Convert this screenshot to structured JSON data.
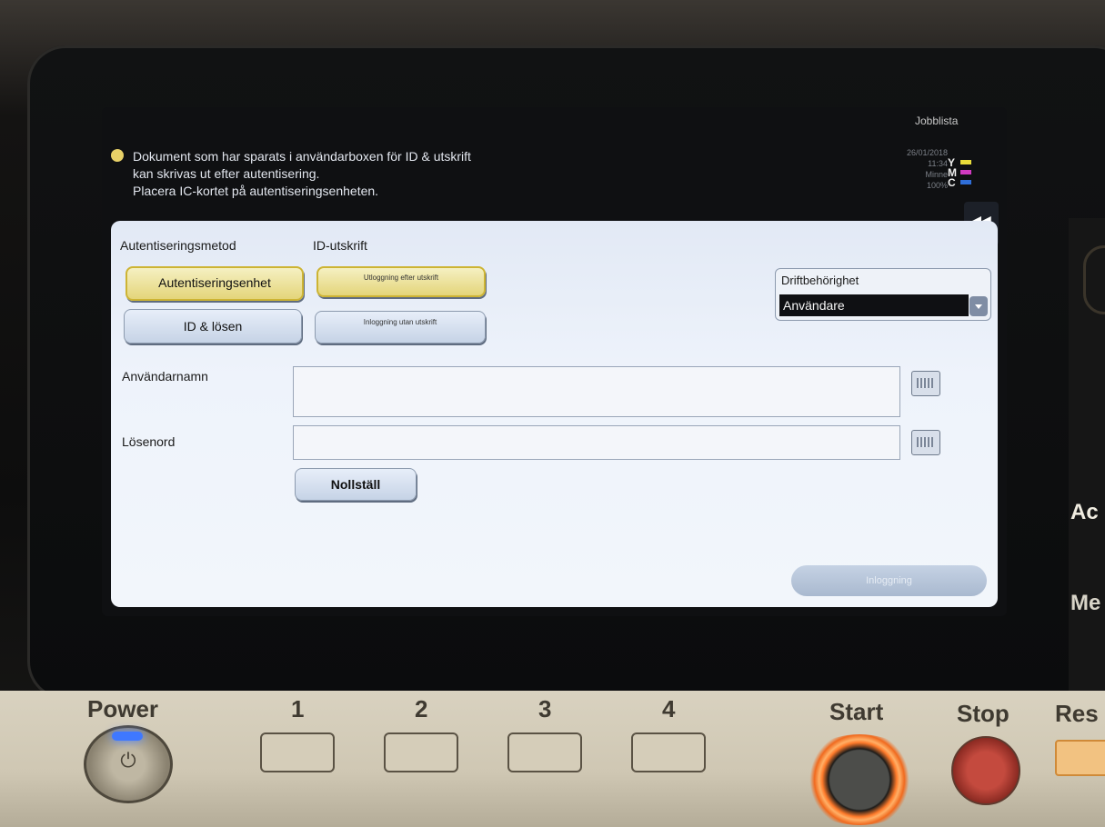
{
  "header": {
    "job_list": "Jobblista",
    "message_lines": [
      "Dokument som har sparats i användarboxen för ID & utskrift",
      "kan skrivas ut efter autentisering.",
      "Placera IC-kortet på autentiseringsenheten."
    ],
    "status": {
      "datetime_line1": "26/01/2018",
      "datetime_line2": "11:34",
      "memory_label": "Minne",
      "memory_value": "100%",
      "ink": [
        {
          "label": "Y",
          "color": "#e8dc3a"
        },
        {
          "label": "M",
          "color": "#d03ac0"
        },
        {
          "label": "C",
          "color": "#2f6ed8"
        }
      ]
    }
  },
  "auth": {
    "method_label": "Autentiseringsmetod",
    "id_print_label": "ID-utskrift",
    "btn_auth_device": "Autentiseringsenhet",
    "btn_id_password": "ID & lösen",
    "btn_logout_after_print": "Utloggning efter utskrift",
    "btn_login_without_print": "Inloggning utan utskrift",
    "operation_rights_label": "Driftbehörighet",
    "operation_rights_value": "Användare",
    "username_label": "Användarnamn",
    "username_value": "",
    "password_label": "Lösenord",
    "password_value": "",
    "reset_button": "Nollställ",
    "login_button": "Inloggning"
  },
  "hardware": {
    "power": "Power",
    "key1": "1",
    "key2": "2",
    "key3": "3",
    "key4": "4",
    "start": "Start",
    "stop": "Stop",
    "reset": "Res",
    "side_text_1": "Ac",
    "side_text_2": "Me"
  },
  "colors": {
    "selected_button": "#e4d57a",
    "panel_bg": "#eef3fb",
    "start_glow": "#ff7a2a",
    "power_led": "#3f78ff"
  }
}
